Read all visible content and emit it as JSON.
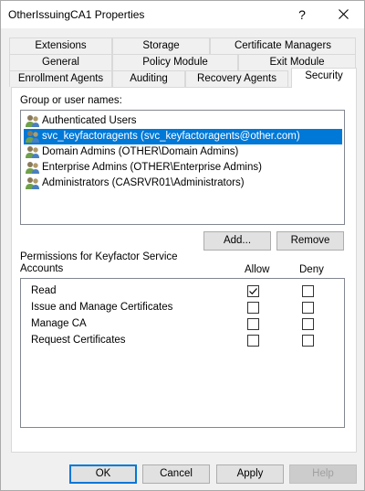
{
  "window": {
    "title": "OtherIssuingCA1 Properties",
    "help_glyph": "?",
    "close_icon": "close-icon"
  },
  "tabs": {
    "row1": [
      "Extensions",
      "Storage",
      "Certificate Managers"
    ],
    "row2": [
      "General",
      "Policy Module",
      "Exit Module"
    ],
    "row3": [
      "Enrollment Agents",
      "Auditing",
      "Recovery Agents",
      "Security"
    ],
    "active": "Security"
  },
  "security": {
    "group_label": "Group or user names:",
    "users": [
      {
        "name": "Authenticated Users",
        "selected": false
      },
      {
        "name": "svc_keyfactoragents (svc_keyfactoragents@other.com)",
        "selected": true
      },
      {
        "name": "Domain Admins (OTHER\\Domain Admins)",
        "selected": false
      },
      {
        "name": "Enterprise Admins (OTHER\\Enterprise Admins)",
        "selected": false
      },
      {
        "name": "Administrators (CASRVR01\\Administrators)",
        "selected": false
      }
    ],
    "add_button": "Add...",
    "remove_button": "Remove",
    "permissions_label_line1": "Permissions for Keyfactor Service",
    "permissions_label_line2": "Accounts",
    "allow_header": "Allow",
    "deny_header": "Deny",
    "permissions": [
      {
        "name": "Read",
        "allow": true,
        "deny": false
      },
      {
        "name": "Issue and Manage Certificates",
        "allow": false,
        "deny": false
      },
      {
        "name": "Manage CA",
        "allow": false,
        "deny": false
      },
      {
        "name": "Request Certificates",
        "allow": false,
        "deny": false
      }
    ]
  },
  "footer": {
    "ok": "OK",
    "cancel": "Cancel",
    "apply": "Apply",
    "help": "Help"
  },
  "colors": {
    "selection": "#0078d7",
    "default_button_border": "#0078d7"
  }
}
